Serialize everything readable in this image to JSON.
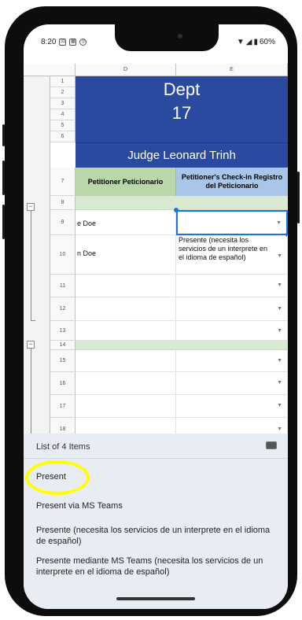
{
  "status_bar": {
    "time": "8:20",
    "battery": "60%"
  },
  "sheet": {
    "columns": [
      "D",
      "E"
    ],
    "title_line1": "Dept",
    "title_line2": "17",
    "judge": "Judge Leonard Trinh",
    "header_petitioner": "Petitioner Peticionario",
    "header_checkin": "Petitioner's Check-in Registro del Peticionario",
    "rows": [
      {
        "num": "1"
      },
      {
        "num": "2"
      },
      {
        "num": "3"
      },
      {
        "num": "4"
      },
      {
        "num": "5"
      },
      {
        "num": "6"
      },
      {
        "num": "7"
      },
      {
        "num": "8"
      },
      {
        "num": "9",
        "name": "e Doe",
        "checkin": ""
      },
      {
        "num": "10",
        "name": "n Doe",
        "checkin": "Presente (necesita los servicios de un interprete en el idioma de español)"
      },
      {
        "num": "11"
      },
      {
        "num": "12"
      },
      {
        "num": "13"
      },
      {
        "num": "14"
      },
      {
        "num": "15"
      },
      {
        "num": "16"
      },
      {
        "num": "17"
      },
      {
        "num": "18"
      }
    ]
  },
  "picker": {
    "title": "List of 4 Items",
    "options": [
      "Present",
      "Present via MS Teams",
      "Presente (necesita los servicios de un interprete en el idioma de español)",
      "Presente mediante MS Teams (necesita los servicios de un interprete en el idioma de español)"
    ]
  }
}
